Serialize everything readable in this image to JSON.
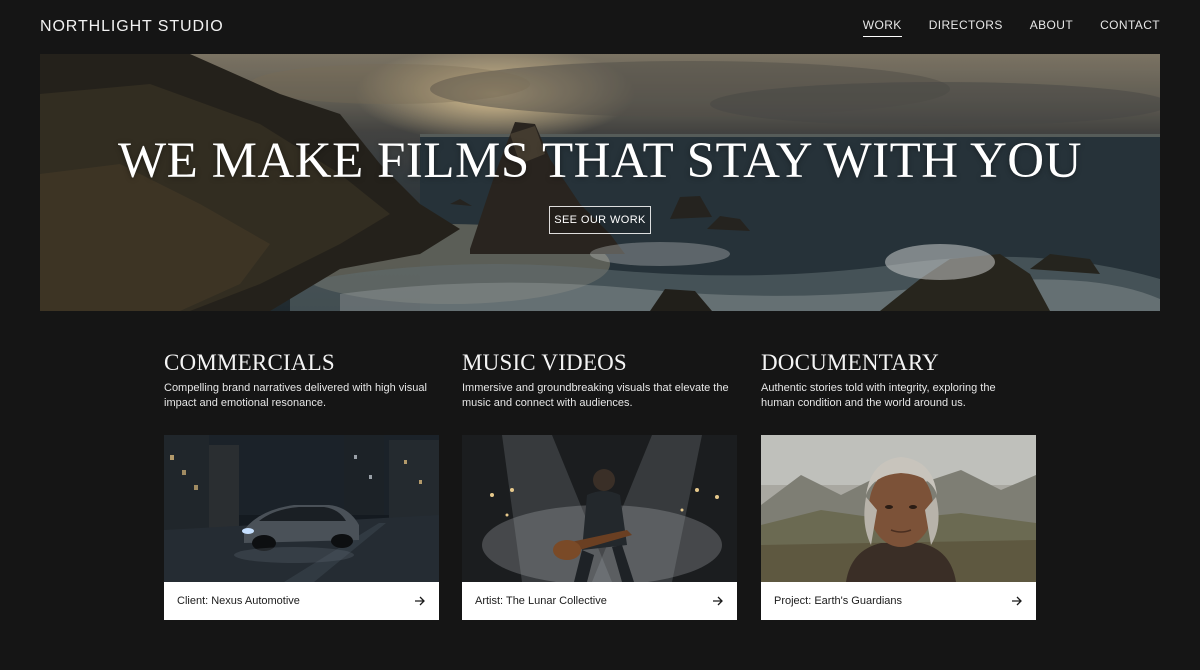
{
  "header": {
    "brand": "NORTHLIGHT STUDIO",
    "nav": [
      {
        "label": "WORK",
        "active": true
      },
      {
        "label": "DIRECTORS",
        "active": false
      },
      {
        "label": "ABOUT",
        "active": false
      },
      {
        "label": "CONTACT",
        "active": false
      }
    ]
  },
  "hero": {
    "title": "WE MAKE FILMS THAT STAY WITH YOU",
    "cta_label": "SEE OUR WORK",
    "image": "coastal-cliffs-sunset-photo"
  },
  "categories": [
    {
      "title": "COMMERCIALS",
      "description": "Compelling brand narratives delivered with high visual impact and emotional resonance.",
      "card_label": "Client: Nexus Automotive",
      "image": "night-city-car-photo"
    },
    {
      "title": "MUSIC VIDEOS",
      "description": "Immersive and groundbreaking visuals that elevate the music and connect with audiences.",
      "card_label": "Artist: The Lunar Collective",
      "image": "guitarist-on-stage-photo"
    },
    {
      "title": "DOCUMENTARY",
      "description": "Authentic stories told with integrity, exploring the human condition and the world around us.",
      "card_label": "Project: Earth's Guardians",
      "image": "elder-portrait-photo"
    }
  ],
  "icons": {
    "card_arrow": "arrow-right-icon"
  },
  "colors": {
    "background": "#151515",
    "text": "#ffffff",
    "card_footer": "#ffffff",
    "card_text": "#1b1b1b"
  }
}
